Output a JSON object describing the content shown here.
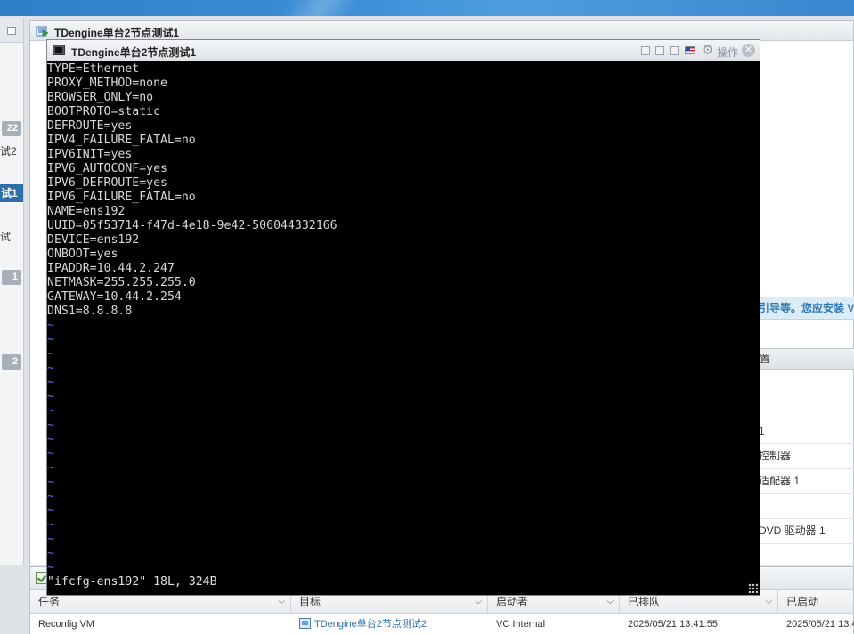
{
  "left_pane": {
    "items": [
      {
        "badge": "22"
      },
      {
        "text": "试2"
      },
      {
        "text": "试1",
        "selected": true
      },
      {
        "text": "试"
      },
      {
        "badge": "1"
      },
      {
        "badge": "2"
      }
    ]
  },
  "main_panel": {
    "title": "TDengine单台2节点测试1",
    "info_bar_text": "引导等。您应安装 V",
    "hw_table": {
      "header": "置",
      "rows": [
        "",
        "",
        "1",
        "控制器",
        "适配器 1",
        "",
        "DVD 驱动器 1"
      ]
    }
  },
  "console": {
    "title": "TDengine单台2节点测试1",
    "ops_label": "操作",
    "lines": [
      "TYPE=Ethernet",
      "PROXY_METHOD=none",
      "BROWSER_ONLY=no",
      "BOOTPROTO=static",
      "DEFROUTE=yes",
      "IPV4_FAILURE_FATAL=no",
      "IPV6INIT=yes",
      "IPV6_AUTOCONF=yes",
      "IPV6_DEFROUTE=yes",
      "IPV6_FAILURE_FATAL=no",
      "NAME=ens192",
      "UUID=05f53714-f47d-4e18-9e42-506044332166",
      "DEVICE=ens192",
      "ONBOOT=yes",
      "IPADDR=10.44.2.247",
      "NETMASK=255.255.255.0",
      "GATEWAY=10.44.2.254",
      "DNS1=8.8.8.8"
    ],
    "tilde": "~",
    "tilde_count": 18,
    "status_line": "\"ifcfg-ens192\" 18L, 324B"
  },
  "tasks": {
    "columns": [
      "任务",
      "目标",
      "启动者",
      "已排队",
      "已启动"
    ],
    "row": {
      "task": "Reconfig VM",
      "target": "TDengine单台2节点测试2",
      "initiator": "VC Internal",
      "queued": "2025/05/21 13:41:55",
      "started": "2025/05/21 13:41"
    }
  }
}
